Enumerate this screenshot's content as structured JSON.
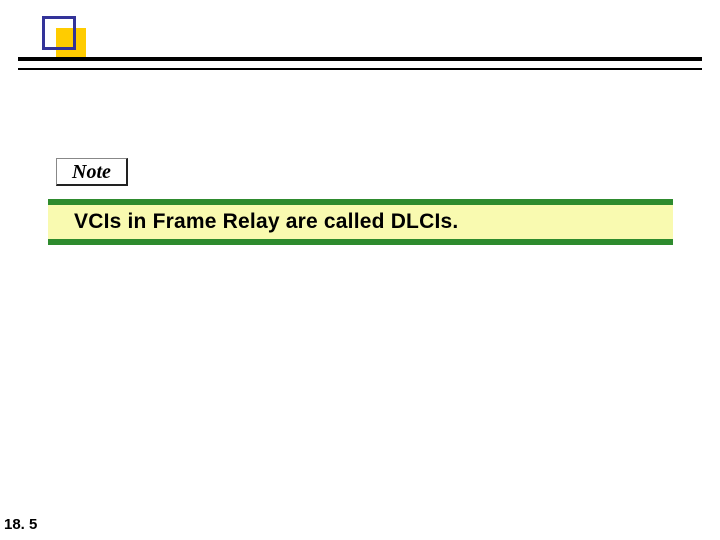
{
  "note": {
    "label": "Note"
  },
  "banner": {
    "text": "VCIs in Frame Relay are called DLCIs."
  },
  "page": {
    "number": "18. 5"
  }
}
